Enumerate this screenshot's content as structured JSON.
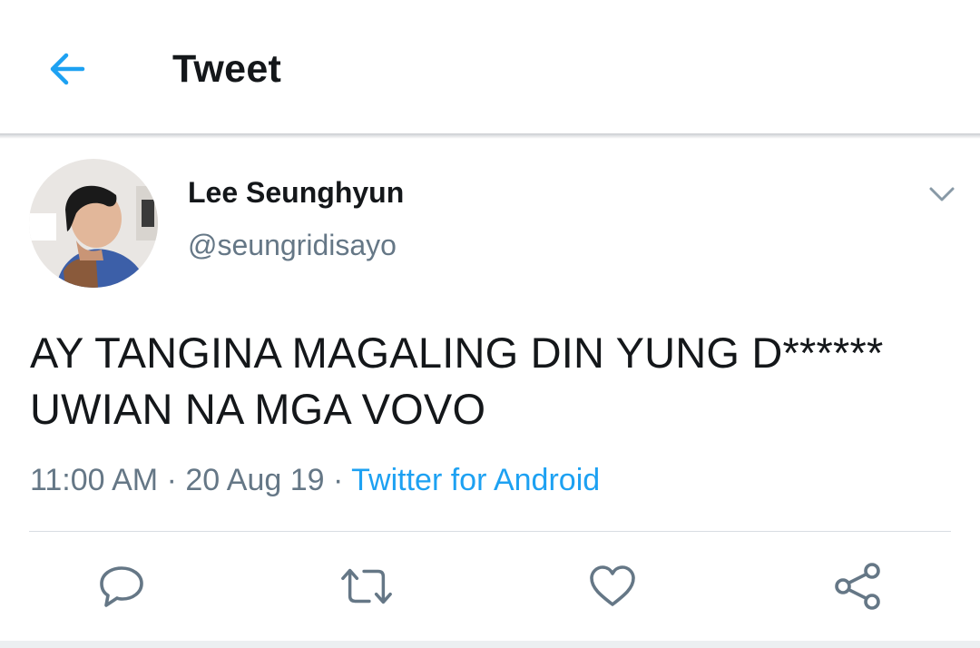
{
  "header": {
    "title": "Tweet",
    "back_icon": "arrow-left-icon"
  },
  "tweet": {
    "author": {
      "display_name": "Lee Seunghyun",
      "handle": "@seungridisayo"
    },
    "text_lines": [
      "AY TANGINA MAGALING DIN YUNG D******",
      "UWIAN NA MGA VOVO"
    ],
    "time": "11:00 AM",
    "separator": "·",
    "date": "20 Aug 19",
    "source": "Twitter for Android"
  },
  "actions": [
    "reply-icon",
    "retweet-icon",
    "like-icon",
    "share-icon"
  ],
  "colors": {
    "accent": "#1da1f2",
    "text": "#14171a",
    "muted": "#657786",
    "icon": "#657786"
  }
}
